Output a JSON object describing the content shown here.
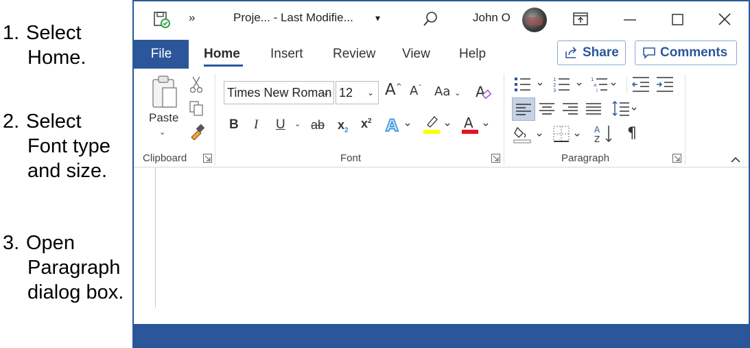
{
  "instructions": [
    {
      "num": "1.",
      "line1": "Select",
      "line2": "Home."
    },
    {
      "num": "2.",
      "line1": "Select",
      "line2": "Font type",
      "line3": "and size."
    },
    {
      "num": "3.",
      "line1": "Open",
      "line2": "Paragraph",
      "line3": "dialog box."
    }
  ],
  "titlebar": {
    "overflow": "»",
    "doc_title": "Proje...  -  Last Modifie...",
    "dropdown": "▾",
    "user_name": "John O"
  },
  "tabs": {
    "file": "File",
    "items": [
      "Home",
      "Insert",
      "Review",
      "View",
      "Help"
    ],
    "share": "Share",
    "comments": "Comments"
  },
  "ribbon": {
    "clipboard": {
      "paste": "Paste",
      "label": "Clipboard"
    },
    "font": {
      "family": "Times New Roman",
      "size": "12",
      "grow": "A",
      "shrink": "A",
      "change_case": "Aa",
      "bold": "B",
      "italic": "I",
      "underline": "U",
      "strike": "ab",
      "subscript": "x",
      "superscript": "x",
      "label": "Font"
    },
    "paragraph": {
      "pilcrow": "¶",
      "label": "Paragraph"
    }
  },
  "colors": {
    "accent": "#2b579a",
    "highlight": "#ffff00",
    "font_color": "#e81123",
    "text_effect": "#2b88d8"
  }
}
